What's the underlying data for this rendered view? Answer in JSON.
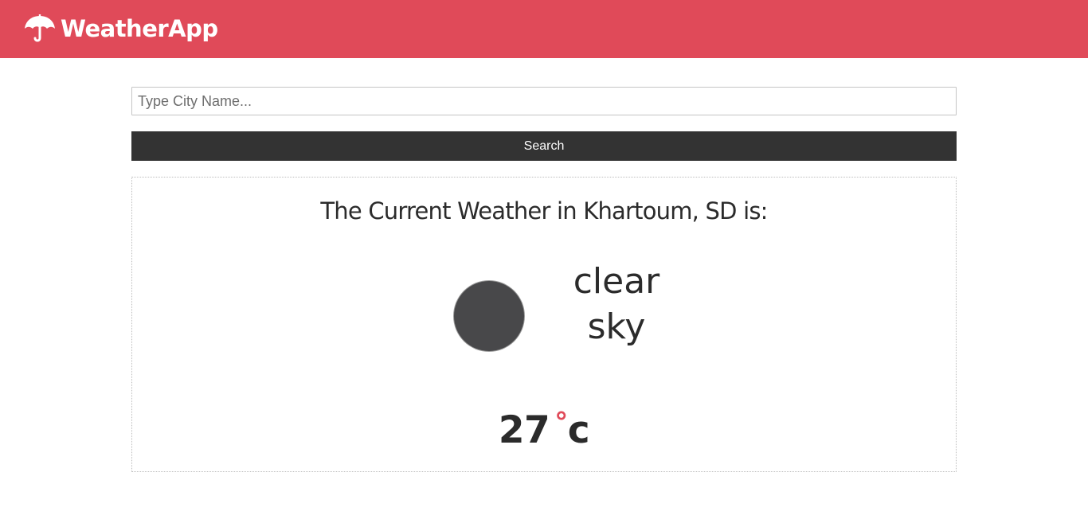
{
  "header": {
    "app_title": "WeatherApp",
    "logo_icon": "umbrella-icon",
    "bar_color": "#e04a59"
  },
  "search": {
    "placeholder": "Type City Name...",
    "value": "",
    "button_label": "Search"
  },
  "result": {
    "heading": "The Current Weather in Khartoum, SD is:",
    "condition_icon": "weather-condition-icon",
    "description_line1": "clear",
    "description_line2": "sky",
    "temperature_value": "27",
    "degree_symbol": "°",
    "unit": "c"
  },
  "colors": {
    "accent": "#e04a59",
    "button_bg": "#333333",
    "text": "#2b2b2b"
  }
}
